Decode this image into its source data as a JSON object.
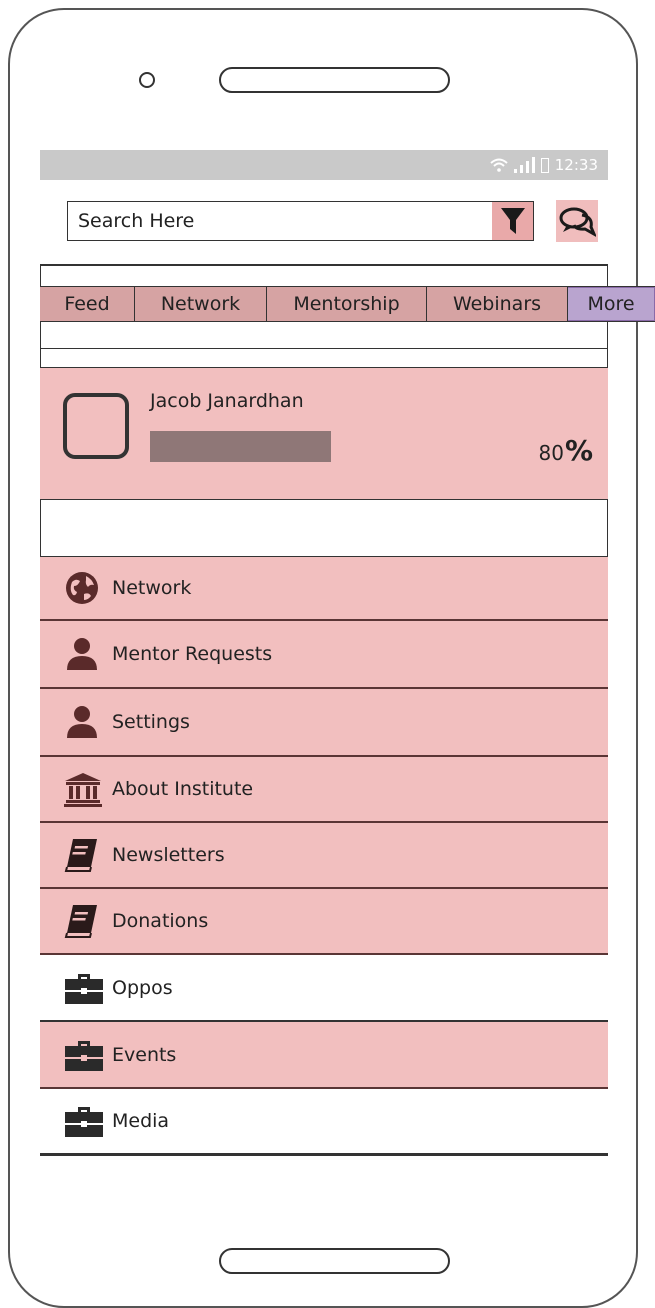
{
  "status_bar": {
    "time": "12:33"
  },
  "search": {
    "placeholder": "Search Here"
  },
  "tabs": [
    {
      "label": "Feed"
    },
    {
      "label": "Network"
    },
    {
      "label": "Mentorship"
    },
    {
      "label": "Webinars"
    },
    {
      "label": "More"
    }
  ],
  "profile": {
    "name": "Jacob Janardhan",
    "completion_value": "80",
    "completion_unit": "%",
    "completion_fraction": 0.8
  },
  "menu": {
    "items": [
      {
        "label": "Network",
        "icon": "globe-icon"
      },
      {
        "label": "Mentor Requests",
        "icon": "user-icon"
      },
      {
        "label": "Settings",
        "icon": "user-icon"
      },
      {
        "label": "About Institute",
        "icon": "institution-icon"
      },
      {
        "label": "Newsletters",
        "icon": "book-icon"
      },
      {
        "label": "Donations",
        "icon": "book-icon"
      },
      {
        "label": "Oppos",
        "icon": "briefcase-icon"
      },
      {
        "label": "Events",
        "icon": "briefcase-icon"
      },
      {
        "label": "Media",
        "icon": "briefcase-icon"
      }
    ]
  },
  "colors": {
    "pink_row": "#f2bfbf",
    "tab_bg": "#d6a3a3",
    "more_tab_bg": "#b9a4cf",
    "icon_dark": "#5a2a2a",
    "progress_fill": "#8f7777"
  }
}
